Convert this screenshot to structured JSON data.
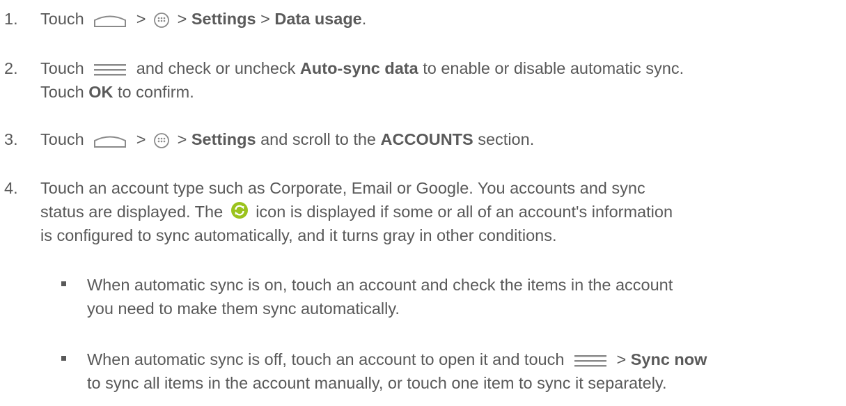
{
  "steps": [
    {
      "num": "1.",
      "touch": "Touch",
      "sep1": ">",
      "sep2": ">",
      "settings": "Settings",
      "sep3": ">",
      "data_usage": "Data usage",
      "end": "."
    },
    {
      "num": "2.",
      "touch": "Touch",
      "mid": "and check or uncheck",
      "auto_sync": "Auto-sync data",
      "tail": "to enable or disable automatic sync.",
      "line2_touch": "Touch",
      "ok": "OK",
      "line2_tail": "to confirm."
    },
    {
      "num": "3.",
      "touch": "Touch",
      "sep1": ">",
      "sep2": ">",
      "settings": "Settings",
      "mid": "and scroll to the",
      "accounts": "ACCOUNTS",
      "tail": "section."
    },
    {
      "num": "4.",
      "line1": "Touch an account type such as Corporate, Email or Google. You accounts and sync",
      "line2_a": "status are displayed. The",
      "line2_b": "icon is displayed if some or all of an account's information",
      "line3": "is configured to sync automatically, and it turns gray in other conditions."
    }
  ],
  "bullets": [
    {
      "line1": "When automatic sync is on, touch an account and check the items in the account",
      "line2": "you need to make them sync automatically."
    },
    {
      "line1_a": "When automatic sync is off, touch an account to open it and touch",
      "sep": ">",
      "sync_now": "Sync now",
      "line2": "to sync all items in the account manually, or touch one item to sync it separately."
    }
  ],
  "icons": {
    "home": "home-icon",
    "apps": "apps-icon",
    "menu": "menu-icon",
    "sync": "sync-icon"
  },
  "colors": {
    "text": "#595959",
    "sync_green": "#9bc31d"
  }
}
